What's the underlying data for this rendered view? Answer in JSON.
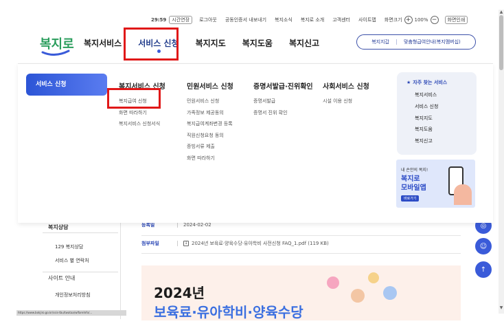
{
  "utility": {
    "timer": "29:59",
    "extend": "시간연장",
    "links": [
      "로그아웃",
      "공동인증서 내보내기",
      "복지소식",
      "복지로 소개",
      "고객센터",
      "사이트맵"
    ],
    "zoom_label": "화면크기",
    "zoom_value": "100%",
    "zoom_in": "+",
    "zoom_out": "−",
    "print": "화면인쇄"
  },
  "logo_text": "복지로",
  "gnb": [
    {
      "label": "복지서비스"
    },
    {
      "label": "서비스 신청"
    },
    {
      "label": "복지지도"
    },
    {
      "label": "복지도움"
    },
    {
      "label": "복지신고"
    }
  ],
  "header_pill": {
    "left": "복지지갑",
    "right": "맞춤형급여안내(복지멤버십)"
  },
  "mega": {
    "category": "서비스 신청",
    "columns": [
      {
        "head": "복지서비스 신청",
        "items": [
          "복지급여 신청",
          "화면 따라하기",
          "복지서비스 신청서식"
        ]
      },
      {
        "head": "민원서비스 신청",
        "items": [
          "민원서비스 신청",
          "가족정보 제공동의",
          "복지급여계좌변경 등록",
          "직원신청요청 동의",
          "증빙서류 제출",
          "화면 따라하기"
        ]
      },
      {
        "head": "증명서발급·진위확인",
        "items": [
          "증명서발급",
          "증명서 진위 확인"
        ]
      },
      {
        "head": "사회서비스 신청",
        "items": [
          "시설 이용 신청"
        ]
      }
    ],
    "frequent": {
      "title": "자주 찾는 서비스",
      "items": [
        "복지서비스",
        "서비스 신청",
        "복지지도",
        "복지도움",
        "복지신고"
      ]
    },
    "banner": {
      "line1": "내 손안의 복지!",
      "line2": "복지로",
      "line3": "모바일앱",
      "button": "바로가기"
    }
  },
  "left_nav": {
    "head": "복지상담",
    "items": [
      "129 복지상담",
      "서비스 별 연락처"
    ],
    "section": "사이트 안내",
    "section_items": [
      "개인정보처리방침"
    ]
  },
  "meta": {
    "date_label": "등록일",
    "date_value": "2024-02-02",
    "file_label": "첨부파일",
    "file_value": "2024년 보육료·양육수당·유아학비 사전신청 FAQ_1.pdf (119 KB)"
  },
  "poster": {
    "year": "2024년",
    "subtitle": "보육료·유아학비·양육수당"
  },
  "status_url": "https://www.bokjiro.go.kr/ssis-tbu/twataa/wlfareInfo/..."
}
